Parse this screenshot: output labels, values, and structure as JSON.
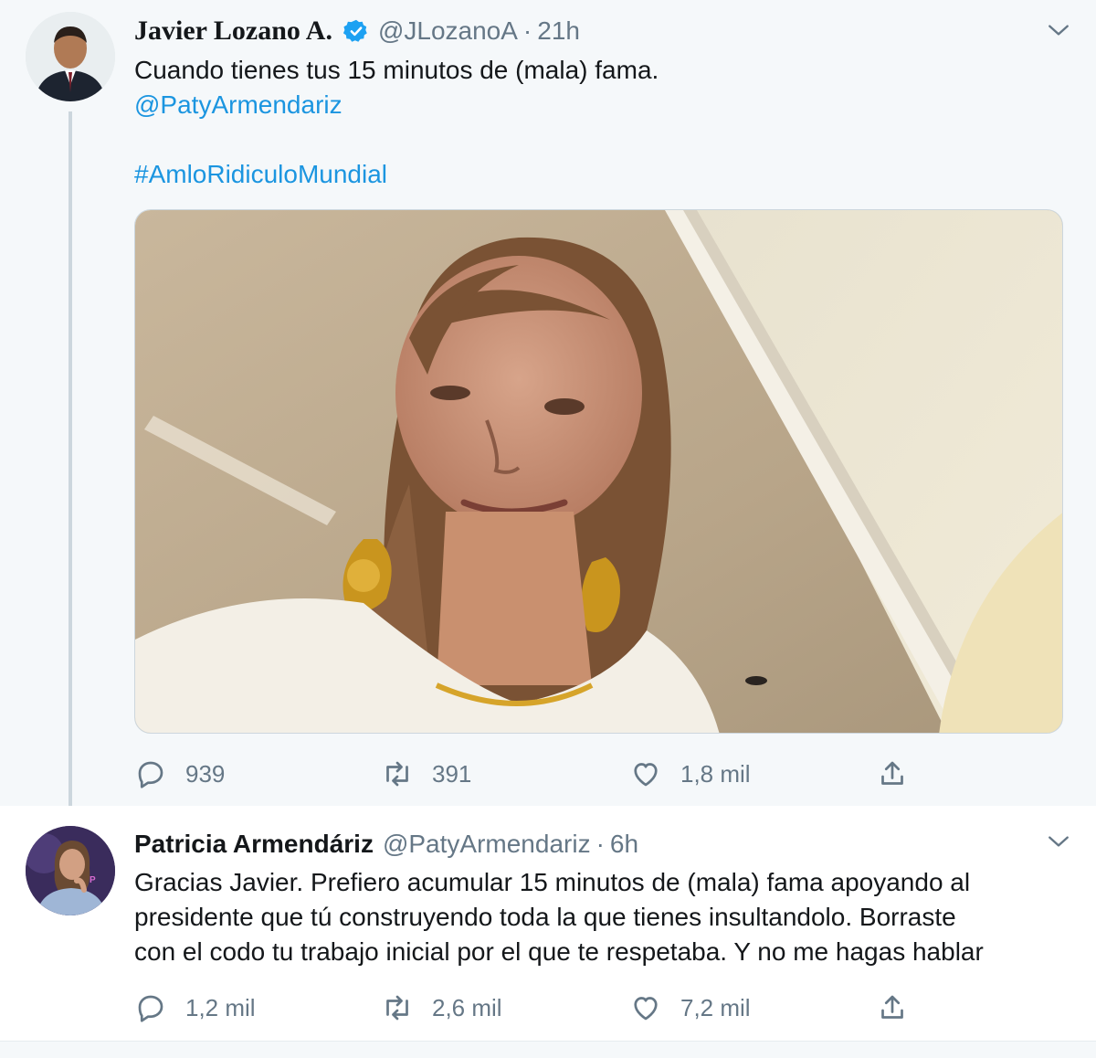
{
  "tweets": [
    {
      "name": "Javier Lozano A.",
      "verified": true,
      "handle": "@JLozanoA",
      "separator": "·",
      "time": "21h",
      "text_line1": "Cuando tienes tus 15 minutos de (mala) fama.",
      "mention": "@PatyArmendariz",
      "hashtag": "#AmloRidiculoMundial",
      "has_media": true,
      "replies": "939",
      "retweets": "391",
      "likes": "1,8 mil"
    },
    {
      "name": "Patricia Armendáriz",
      "handle": "@PatyArmendariz",
      "separator": "·",
      "time": "6h",
      "text_lines": [
        "Gracias Javier. Prefiero acumular 15 minutos de (mala) fama apoyando al",
        "presidente que tú construyendo toda la que tienes insultandolo. Borraste",
        "con el codo tu trabajo inicial por el que te respetaba. Y no me hagas hablar"
      ],
      "replies": "1,2 mil",
      "retweets": "2,6 mil",
      "likes": "7,2 mil"
    }
  ],
  "colors": {
    "link": "#1b95e0",
    "muted": "#657786",
    "verified": "#1da1f2",
    "thread_bg": "#f5f8fa"
  }
}
